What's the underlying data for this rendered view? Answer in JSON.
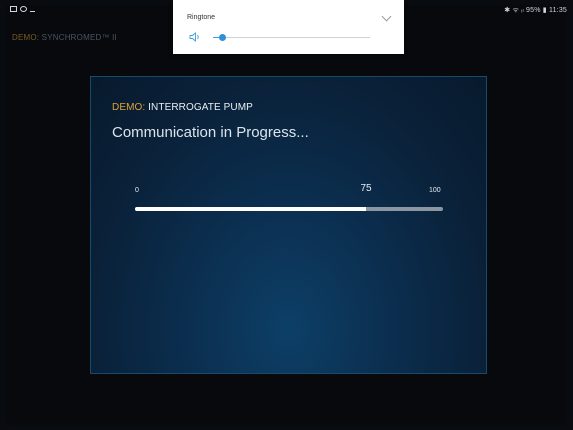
{
  "status_bar": {
    "right_text": "✱ ᯤ ᵢₗ 95% ▮ 11:35",
    "left_icons": [
      "gallery-icon",
      "settings-icon",
      "download-icon"
    ]
  },
  "app_header": {
    "demo_label": "DEMO:",
    "title": "SYNCHROMED™ II"
  },
  "volume_popup": {
    "label": "Ringtone",
    "level": 0.06,
    "icon": "speaker-icon",
    "accent": "#2f90d8"
  },
  "dialog": {
    "demo_label": "DEMO:",
    "title": "INTERROGATE PUMP",
    "message": "Communication in Progress...",
    "progress": {
      "min_label": "0",
      "max_label": "100",
      "value_label": "75",
      "value": 75,
      "max": 100
    }
  },
  "colors": {
    "demo_orange": "#e1a135",
    "dialog_blue": "#0d3f67",
    "progress_fill": "#ffffff",
    "progress_track": "#8c96a2"
  }
}
